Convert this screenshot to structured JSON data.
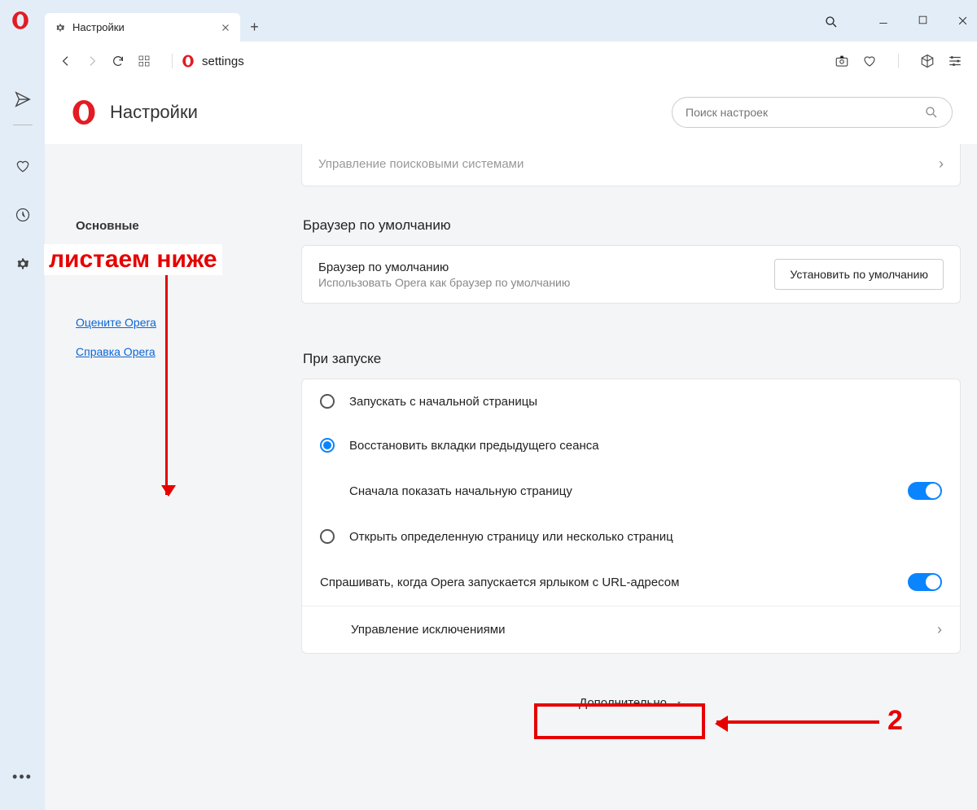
{
  "tab": {
    "title": "Настройки"
  },
  "address": "settings",
  "page": {
    "title": "Настройки",
    "search_placeholder": "Поиск настроек"
  },
  "sidebar": {
    "basic": "Основные",
    "rate": "Оцените Opera",
    "help": "Справка Opera"
  },
  "cutoff_row": "Управление поисковыми системами",
  "default_browser": {
    "section": "Браузер по умолчанию",
    "title": "Браузер по умолчанию",
    "sub": "Использовать Opera как браузер по умолчанию",
    "button": "Установить по умолчанию"
  },
  "startup": {
    "section": "При запуске",
    "opt1": "Запускать с начальной страницы",
    "opt2": "Восстановить вкладки предыдущего сеанса",
    "opt2_sub": "Сначала показать начальную страницу",
    "opt3": "Открыть определенную страницу или несколько страниц",
    "ask": "Спрашивать, когда Opera запускается ярлыком с URL-адресом",
    "exceptions": "Управление исключениями"
  },
  "advanced": "Дополнительно",
  "annotation": {
    "scroll": "листаем ниже",
    "num": "2"
  }
}
